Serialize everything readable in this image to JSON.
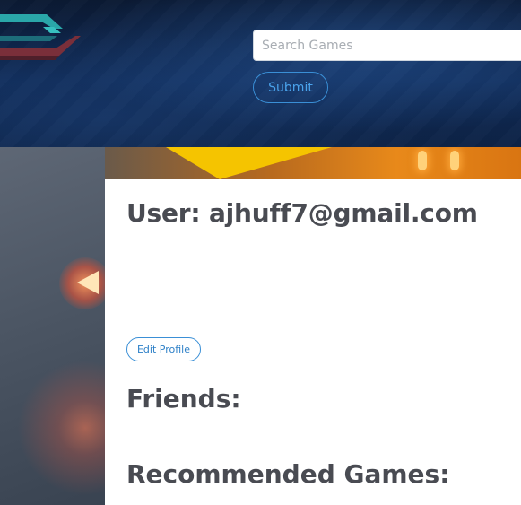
{
  "header": {
    "logo_icon": "brand-logo-icon",
    "search": {
      "placeholder": "Search Games",
      "value": ""
    },
    "submit_label": "Submit"
  },
  "profile": {
    "user_title": "User: ajhuff7@gmail.com",
    "edit_profile_label": "Edit Profile",
    "friends_heading": "Friends:",
    "recommended_heading": "Recommended Games:"
  },
  "colors": {
    "header_bg": "#0f2a55",
    "accent_blue": "#3a8fd6",
    "heading_text": "#494b52",
    "logo_teal": "#2aa7a9",
    "logo_red": "#7a2f3a"
  }
}
